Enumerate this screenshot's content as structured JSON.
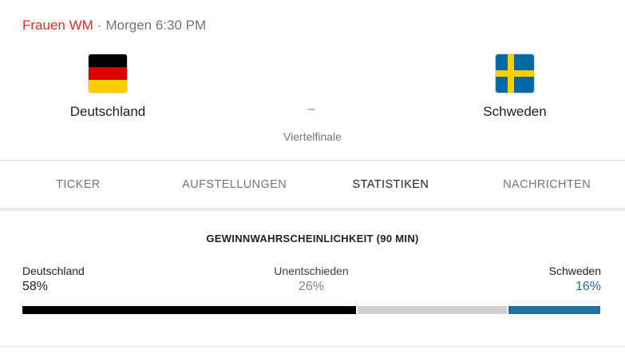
{
  "header": {
    "league": "Frauen WM",
    "separator": "·",
    "time": "Morgen 6:30 PM"
  },
  "match": {
    "home": {
      "name": "Deutschland",
      "flag_icon": "germany-flag-icon"
    },
    "away": {
      "name": "Schweden",
      "flag_icon": "sweden-flag-icon"
    },
    "score": "–",
    "stage": "Viertelfinale"
  },
  "tabs": [
    {
      "label": "TICKER",
      "active": false
    },
    {
      "label": "AUFSTELLUNGEN",
      "active": false
    },
    {
      "label": "STATISTIKEN",
      "active": true
    },
    {
      "label": "NACHRICHTEN",
      "active": false
    }
  ],
  "probability": {
    "title": "GEWINNWAHRSCHEINLICHKEIT (90 MIN)",
    "home": {
      "label": "Deutschland",
      "value": "58%",
      "fraction": 0.58,
      "color": "#000000"
    },
    "draw": {
      "label": "Unentschieden",
      "value": "26%",
      "fraction": 0.26,
      "color": "#d2d2d2"
    },
    "away": {
      "label": "Schweden",
      "value": "16%",
      "fraction": 0.16,
      "color": "#1f6fa8"
    }
  },
  "colors": {
    "league": "#d93025",
    "germany": [
      "#000000",
      "#dd0000",
      "#ffce00"
    ],
    "sweden": {
      "blue": "#006aa7",
      "yellow": "#fecc00"
    }
  }
}
